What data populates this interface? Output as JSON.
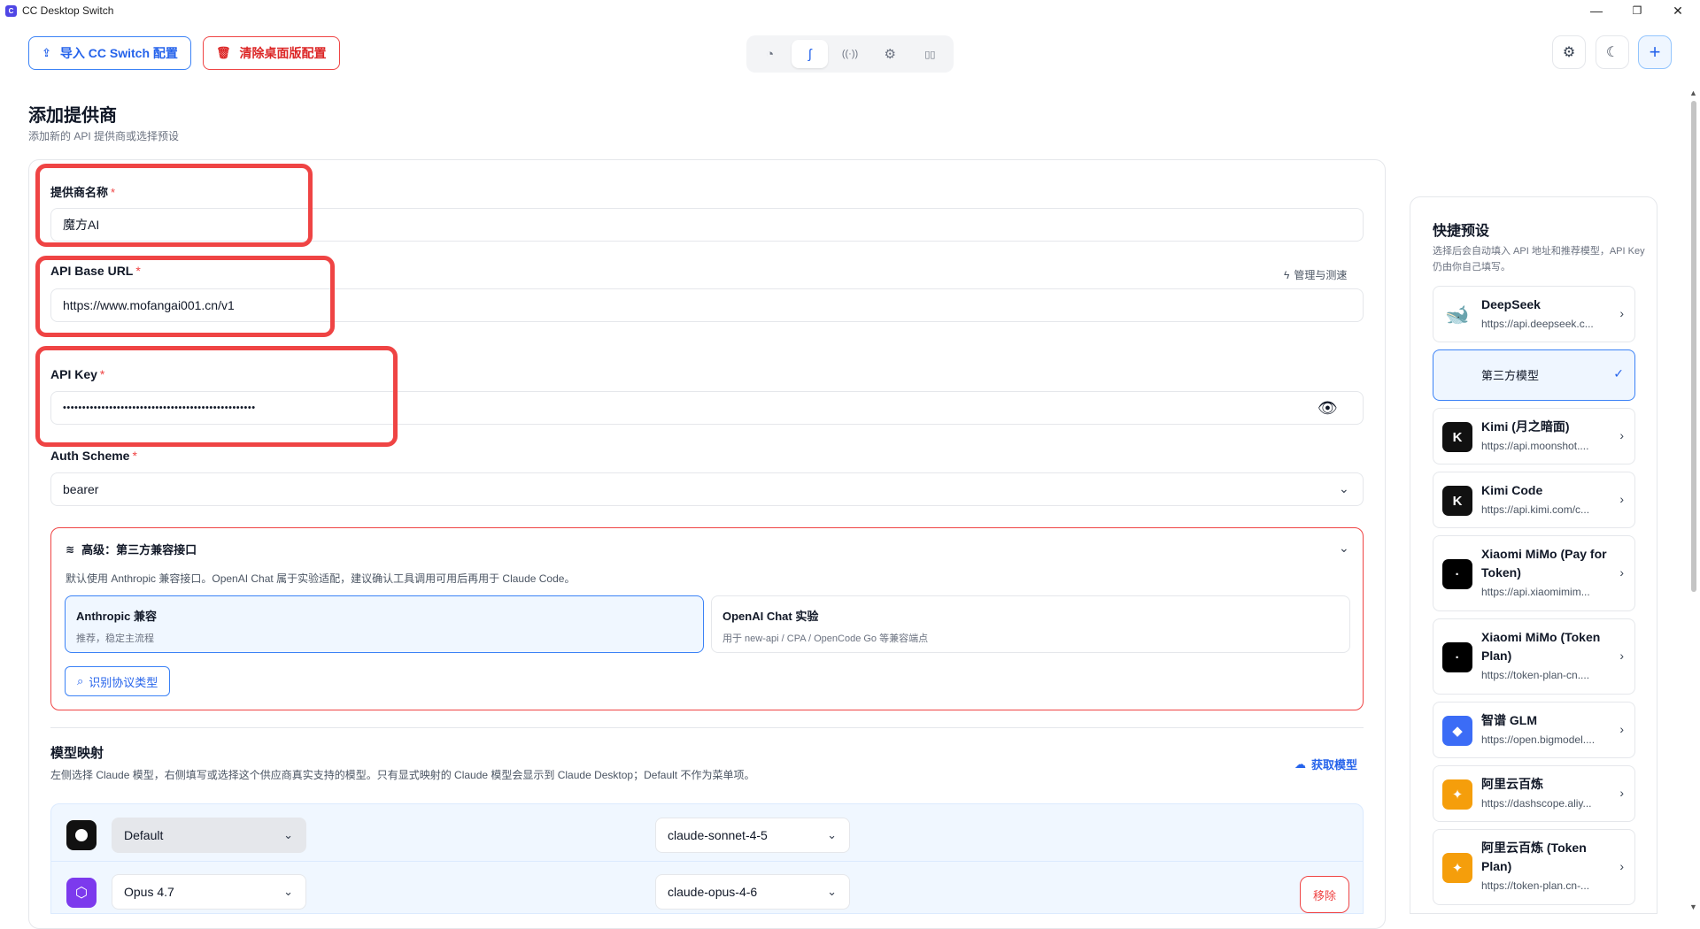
{
  "window": {
    "title": "CC Desktop Switch",
    "icon_text": "C",
    "minimize": "—",
    "maximize": "❐",
    "close": "✕"
  },
  "toolbar": {
    "import_label": "导入 CC Switch 配置",
    "clear_label": "清除桌面版配置",
    "import_icon": "upload-icon",
    "clear_icon": "trash-icon"
  },
  "nav": [
    {
      "icon": "dashboard-icon",
      "glyph": "◔",
      "active": false
    },
    {
      "icon": "provider-icon",
      "glyph": "ʃ",
      "active": true
    },
    {
      "icon": "broadcast-icon",
      "glyph": "((·))",
      "active": false
    },
    {
      "icon": "gear-icon",
      "glyph": "⚙",
      "active": false
    },
    {
      "icon": "book-icon",
      "glyph": "▯▯",
      "active": false
    }
  ],
  "right_buttons": {
    "settings": "⚙",
    "theme": "☾",
    "add": "+"
  },
  "page": {
    "title": "添加提供商",
    "subtitle": "添加新的 API 提供商或选择预设"
  },
  "form": {
    "name_label": "提供商名称",
    "name_value": "魔方AI",
    "base_url_label": "API Base URL",
    "base_url_value": "https://www.mofangai001.cn/v1",
    "manage_link": "管理与测速",
    "api_key_label": "API Key",
    "api_key_value": "••••••••••••••••••••••••••••••••••••••••••••••••••",
    "auth_label": "Auth Scheme",
    "auth_value": "bearer",
    "required_mark": "*"
  },
  "advanced": {
    "title": "高级：第三方兼容接口",
    "desc": "默认使用 Anthropic 兼容接口。OpenAI Chat 属于实验适配，建议确认工具调用可用后再用于 Claude Code。",
    "options": [
      {
        "title": "Anthropic 兼容",
        "desc": "推荐，稳定主流程",
        "selected": true
      },
      {
        "title": "OpenAI Chat 实验",
        "desc": "用于 new-api / CPA / OpenCode Go 等兼容端点",
        "selected": false
      }
    ],
    "detect_label": "识别协议类型"
  },
  "mapping": {
    "title": "模型映射",
    "desc": "左侧选择 Claude 模型，右侧填写或选择这个供应商真实支持的模型。只有显式映射的 Claude 模型会显示到 Claude Desktop；Default 不作为菜单项。",
    "fetch_label": "获取模型",
    "rows": [
      {
        "claude": "Default",
        "target": "claude-sonnet-4-5",
        "icon_color": "#111111",
        "removable": false
      },
      {
        "claude": "Opus 4.7",
        "target": "claude-opus-4-6",
        "icon_color": "#7c3aed",
        "removable": true
      }
    ],
    "remove_label": "移除"
  },
  "presets": {
    "title": "快捷预设",
    "desc": "选择后会自动填入 API 地址和推荐模型，API Key 仍由你自己填写。",
    "items": [
      {
        "name": "DeepSeek",
        "url": "https://api.deepseek.c...",
        "logo": "🐋",
        "color": "#ffffff",
        "fg": "#4d6bfe",
        "selected": false
      },
      {
        "name": "第三方模型",
        "url": "",
        "logo": "",
        "color": "#eff6ff",
        "fg": "#2563eb",
        "selected": true
      },
      {
        "name": "Kimi (月之暗面)",
        "url": "https://api.moonshot....",
        "logo": "K",
        "color": "#111111",
        "fg": "#ffffff",
        "selected": false
      },
      {
        "name": "Kimi Code",
        "url": "https://api.kimi.com/c...",
        "logo": "K",
        "color": "#111111",
        "fg": "#ffffff",
        "selected": false
      },
      {
        "name": "Xiaomi MiMo (Pay for Token)",
        "url": "https://api.xiaomimim...",
        "logo": "·",
        "color": "#000000",
        "fg": "#ffffff",
        "selected": false
      },
      {
        "name": "Xiaomi MiMo (Token Plan)",
        "url": "https://token-plan-cn....",
        "logo": "·",
        "color": "#000000",
        "fg": "#ffffff",
        "selected": false
      },
      {
        "name": "智谱 GLM",
        "url": "https://open.bigmodel....",
        "logo": "◆",
        "color": "#3b6cf6",
        "fg": "#ffffff",
        "selected": false
      },
      {
        "name": "阿里云百炼",
        "url": "https://dashscope.aliy...",
        "logo": "✦",
        "color": "#f59e0b",
        "fg": "#ffffff",
        "selected": false
      },
      {
        "name": "阿里云百炼 (Token Plan)",
        "url": "https://token-plan.cn-...",
        "logo": "✦",
        "color": "#f59e0b",
        "fg": "#ffffff",
        "selected": false
      }
    ]
  }
}
